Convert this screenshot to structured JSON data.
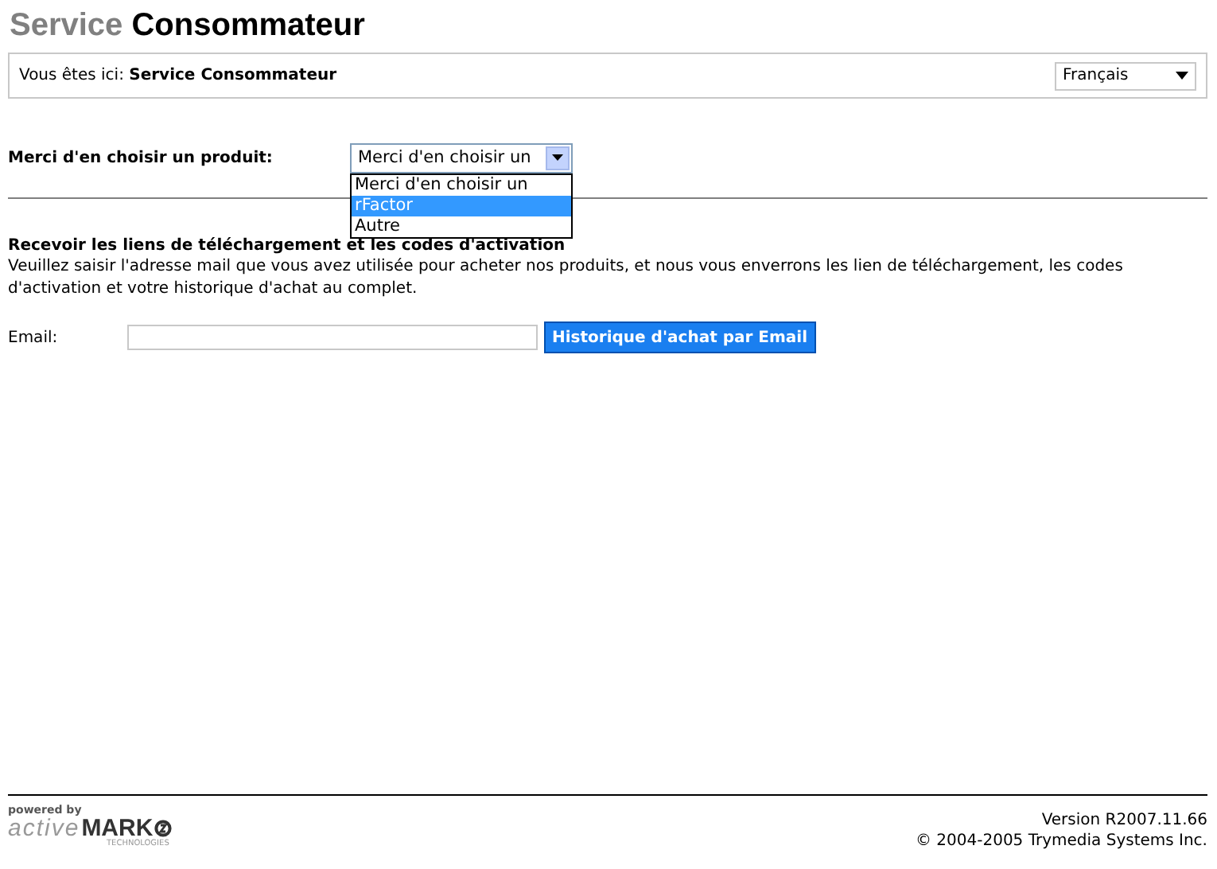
{
  "title": {
    "light": "Service",
    "bold": "Consommateur"
  },
  "breadcrumb": {
    "label": "Vous êtes ici:",
    "current": "Service Consommateur"
  },
  "language_select": {
    "value": "Français"
  },
  "product": {
    "label": "Merci d'en choisir un produit:",
    "value": "Merci d'en choisir un",
    "expanded": true,
    "options": [
      {
        "label": "Merci d'en choisir un",
        "highlighted": false
      },
      {
        "label": "rFactor",
        "highlighted": true
      },
      {
        "label": "Autre",
        "highlighted": false
      }
    ]
  },
  "section": {
    "heading": "Recevoir les liens de téléchargement et les codes d'activation",
    "text": "Veuillez saisir l'adresse mail que vous avez utilisée pour acheter nos produits, et nous vous enverrons les lien de téléchargement, les codes d'activation et votre historique d'achat au complet."
  },
  "email": {
    "label": "Email:",
    "button": "Historique d'achat par Email"
  },
  "footer": {
    "powered_by": "powered by",
    "logo_light": "active",
    "logo_bold": "MARK",
    "logo_sub": "TECHNOLOGIES",
    "version": "Version R2007.11.66",
    "copyright": "© 2004-2005 Trymedia Systems Inc."
  }
}
